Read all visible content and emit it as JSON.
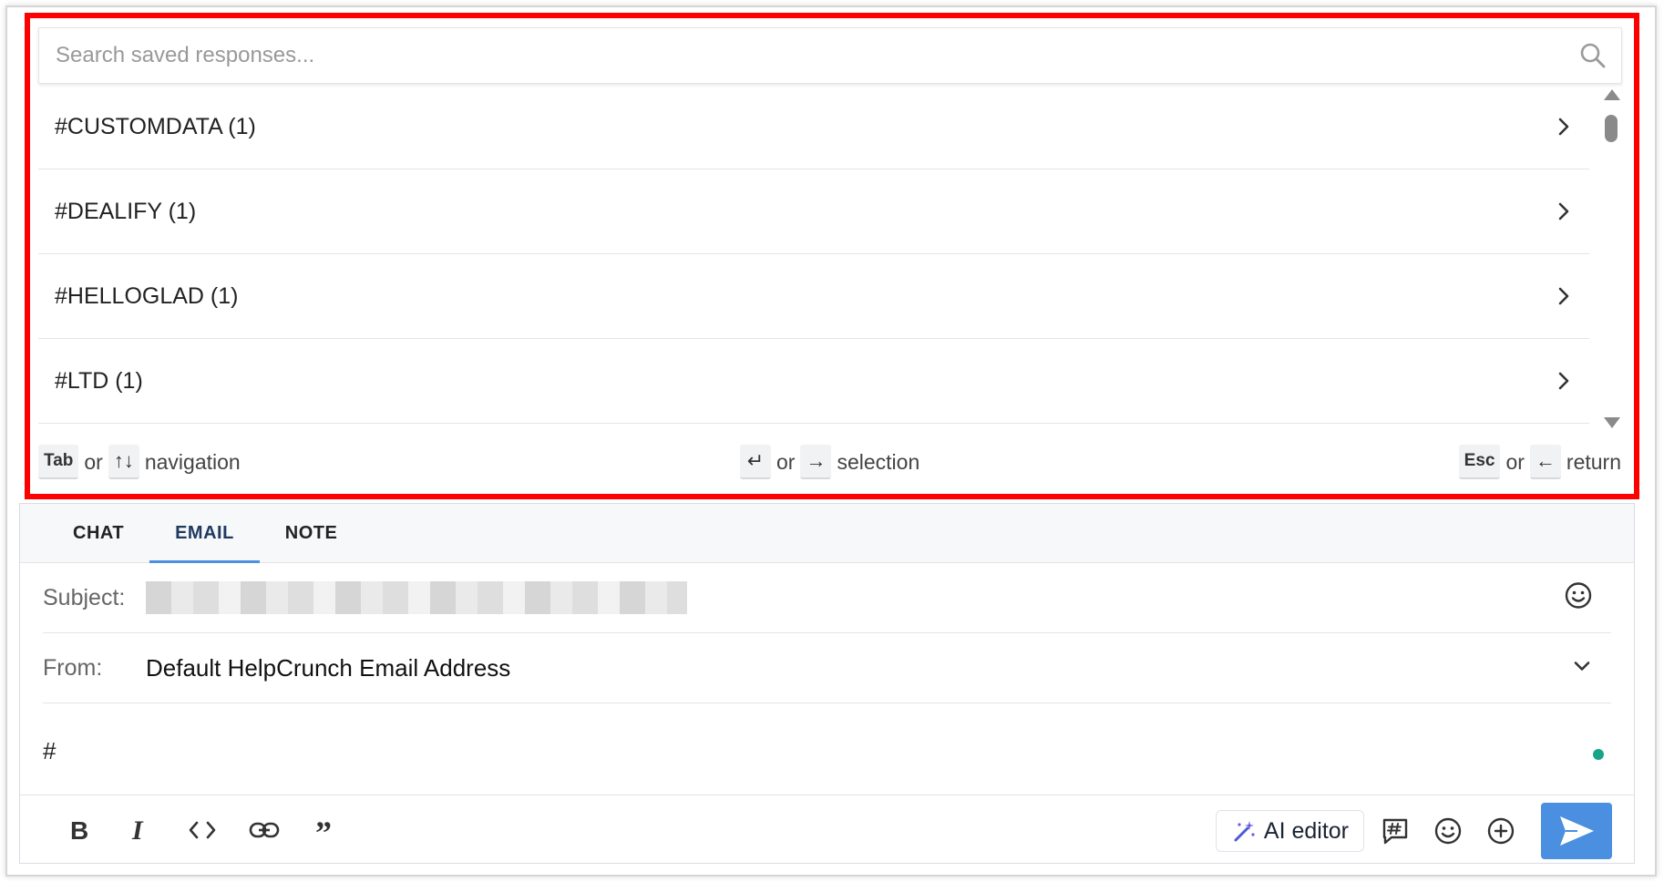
{
  "popup": {
    "search_placeholder": "Search saved responses...",
    "items": [
      {
        "label": "#CUSTOMDATA (1)"
      },
      {
        "label": "#DEALIFY (1)"
      },
      {
        "label": "#HELLOGLAD (1)"
      },
      {
        "label": "#LTD (1)"
      }
    ],
    "hints": {
      "navigation": {
        "key1": "Tab",
        "or": "or",
        "key2": "↑↓",
        "text": "navigation"
      },
      "selection": {
        "key1": "↵",
        "or": "or",
        "key2": "→",
        "text": "selection"
      },
      "return": {
        "key1": "Esc",
        "or": "or",
        "key2": "←",
        "text": "return"
      }
    }
  },
  "composer": {
    "tabs": [
      {
        "label": "CHAT",
        "active": false
      },
      {
        "label": "EMAIL",
        "active": true
      },
      {
        "label": "NOTE",
        "active": false
      }
    ],
    "subject_label": "Subject:",
    "from_label": "From:",
    "from_value": "Default HelpCrunch Email Address",
    "body_text": "#",
    "ai_editor_label": "AI editor",
    "colors": {
      "accent": "#4a8fe0",
      "status": "#17a589",
      "highlight": "#ff0000"
    }
  }
}
